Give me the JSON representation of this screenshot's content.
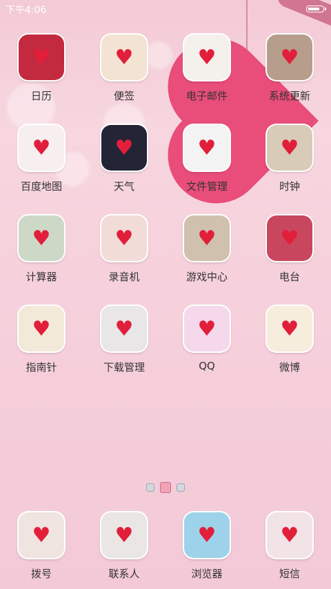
{
  "status_bar": {
    "time": "下午4:06",
    "battery_level": 0.9
  },
  "accent_color": "#e94d79",
  "apps": [
    [
      {
        "label": "日历",
        "icon": "calendar-icon",
        "bg": "#c42a3f",
        "glyph": "♥"
      },
      {
        "label": "便签",
        "icon": "notes-icon",
        "bg": "#f3e3d2",
        "glyph": "♥"
      },
      {
        "label": "电子邮件",
        "icon": "email-icon",
        "bg": "#f4f1ec",
        "glyph": "♥"
      },
      {
        "label": "系统更新",
        "icon": "system-update-icon",
        "bg": "#b79d8c",
        "glyph": "♥"
      }
    ],
    [
      {
        "label": "百度地图",
        "icon": "map-icon",
        "bg": "#f7eef0",
        "glyph": "♥"
      },
      {
        "label": "天气",
        "icon": "weather-icon",
        "bg": "#242437",
        "glyph": "♥"
      },
      {
        "label": "文件管理",
        "icon": "file-manager-icon",
        "bg": "#f3f3f3",
        "glyph": "♥"
      },
      {
        "label": "时钟",
        "icon": "clock-icon",
        "bg": "#d8cbb7",
        "glyph": "♥"
      }
    ],
    [
      {
        "label": "计算器",
        "icon": "calculator-icon",
        "bg": "#cdd8c6",
        "glyph": "♥"
      },
      {
        "label": "录音机",
        "icon": "recorder-icon",
        "bg": "#f2dcd8",
        "glyph": "♥"
      },
      {
        "label": "游戏中心",
        "icon": "game-center-icon",
        "bg": "#cfc1ae",
        "glyph": "♥"
      },
      {
        "label": "电台",
        "icon": "radio-icon",
        "bg": "#c9475e",
        "glyph": "♥"
      }
    ],
    [
      {
        "label": "指南针",
        "icon": "compass-icon",
        "bg": "#f3e9d9",
        "glyph": "♥"
      },
      {
        "label": "下载管理",
        "icon": "download-manager-icon",
        "bg": "#e8e6e6",
        "glyph": "♥"
      },
      {
        "label": "QQ",
        "icon": "qq-icon",
        "bg": "#f6d8ec",
        "glyph": "♥"
      },
      {
        "label": "微博",
        "icon": "weibo-icon",
        "bg": "#f7eddc",
        "glyph": "♥"
      }
    ]
  ],
  "dock": [
    {
      "label": "拨号",
      "icon": "phone-icon",
      "bg": "#f0e4e1",
      "glyph": "♥"
    },
    {
      "label": "联系人",
      "icon": "contacts-icon",
      "bg": "#e9e6e4",
      "glyph": "♥"
    },
    {
      "label": "浏览器",
      "icon": "browser-icon",
      "bg": "#9ed2ea",
      "glyph": "♥"
    },
    {
      "label": "短信",
      "icon": "messages-icon",
      "bg": "#f2e3e6",
      "glyph": "♥"
    }
  ],
  "page_indicator": {
    "pages": 3,
    "active": 1
  }
}
